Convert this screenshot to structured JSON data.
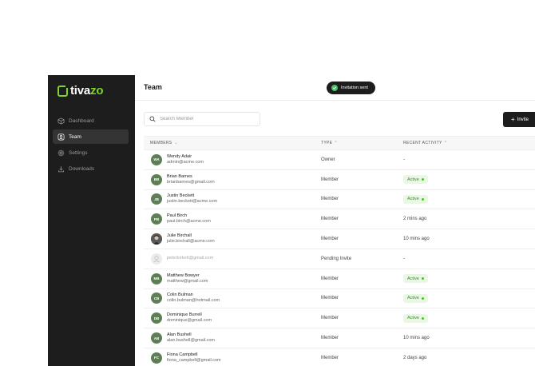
{
  "brand": {
    "name_main": "tiva",
    "name_accent": "zo",
    "accent_color": "#7fd42a"
  },
  "sidebar": {
    "items": [
      {
        "label": "Dashboard",
        "icon": "cube-icon",
        "active": false
      },
      {
        "label": "Team",
        "icon": "user-square-icon",
        "active": true
      },
      {
        "label": "Settings",
        "icon": "gear-icon",
        "active": false
      },
      {
        "label": "Downloads",
        "icon": "download-icon",
        "active": false
      }
    ]
  },
  "header": {
    "title": "Team"
  },
  "toast": {
    "label": "Invitation sent",
    "icon": "check-circle-icon",
    "color": "#4cc26a"
  },
  "search": {
    "placeholder": "Search Member",
    "value": ""
  },
  "invite_button": {
    "label": "Invite"
  },
  "table": {
    "columns": {
      "members": "MEMBERS",
      "type": "TYPE",
      "activity": "RECENT ACTIVITY"
    },
    "rows": [
      {
        "initials": "WA",
        "name": "Wendy Adair",
        "email": "admin@acme.com",
        "type": "Owner",
        "activity": "-",
        "active": false
      },
      {
        "initials": "BB",
        "name": "Brian Barnes",
        "email": "brianbarnes@gmail.com",
        "type": "Member",
        "activity": "Active",
        "active": true
      },
      {
        "initials": "JB",
        "name": "Justin Beckett",
        "email": "justin.beckett@acme.com",
        "type": "Member",
        "activity": "Active",
        "active": true
      },
      {
        "initials": "PB",
        "name": "Paul Birch",
        "email": "paul.birch@acme.com",
        "type": "Member",
        "activity": "2 mins ago",
        "active": false
      },
      {
        "initials": "",
        "name": "Julie Birchall",
        "email": "julie.birchall@acme.com",
        "type": "Member",
        "activity": "10 mins ago",
        "active": false,
        "photo": true
      },
      {
        "initials": "",
        "name": "",
        "email": "peterbirkett@gmail.com",
        "type": "Pending Invite",
        "activity": "-",
        "active": false,
        "pending": true
      },
      {
        "initials": "MB",
        "name": "Matthew Bowyer",
        "email": "matthew@gmail.com",
        "type": "Member",
        "activity": "Active",
        "active": true
      },
      {
        "initials": "CB",
        "name": "Colin Bulman",
        "email": "colin.bulman@hotmail.com",
        "type": "Member",
        "activity": "Active",
        "active": true
      },
      {
        "initials": "DB",
        "name": "Dominique Burrell",
        "email": "dominique@gmail.com",
        "type": "Member",
        "activity": "Active",
        "active": true
      },
      {
        "initials": "AB",
        "name": "Alan Bushell",
        "email": "alan.bushell@gmail.com",
        "type": "Member",
        "activity": "10 mins ago",
        "active": false
      },
      {
        "initials": "FC",
        "name": "Fiona Campbell",
        "email": "fiona_campbell@gmail.com",
        "type": "Member",
        "activity": "2 days ago",
        "active": false
      }
    ]
  }
}
